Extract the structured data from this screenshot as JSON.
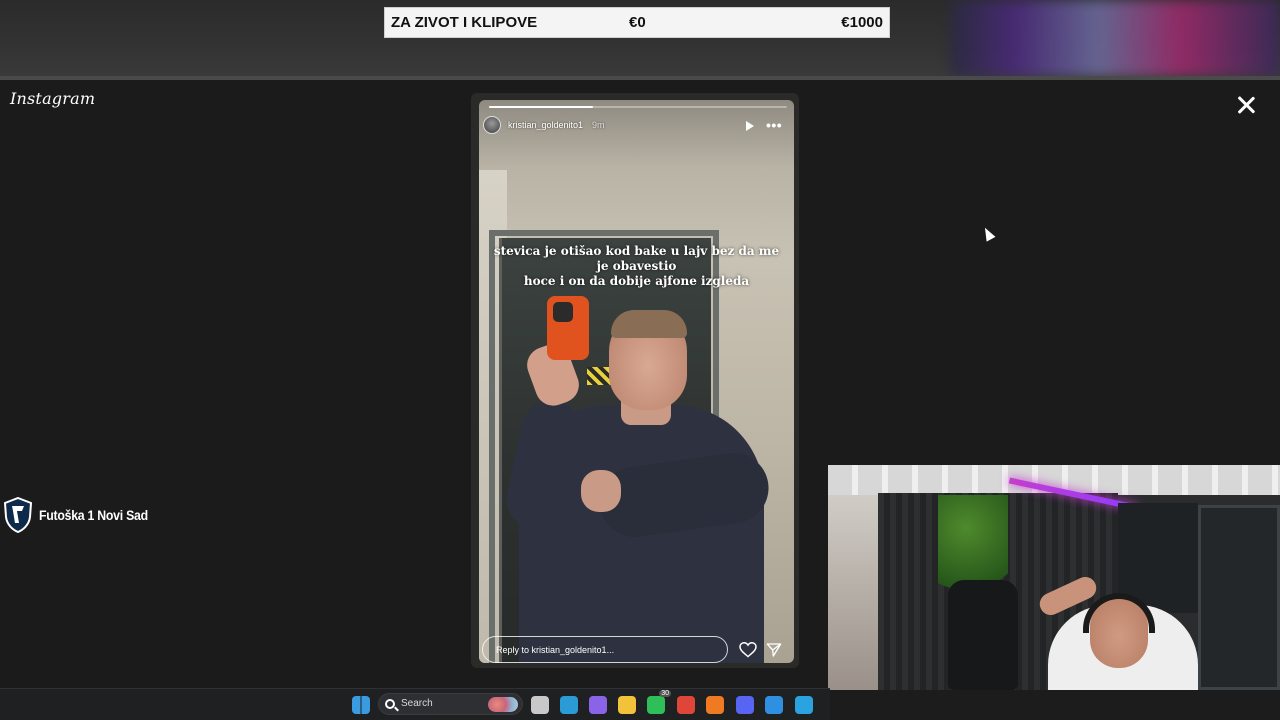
{
  "donation": {
    "title": "ZA ZIVOT I KLIPOVE",
    "current": "€0",
    "goal": "€1000",
    "progress_fraction": 0
  },
  "instagram": {
    "logo_text": "Instagram",
    "story": {
      "username": "kristian_goldenito1",
      "time": "9m",
      "progress_fraction": 0.35,
      "caption_lines": [
        "stevica je otišao kod bake u lajv bez da me",
        "je obavestio",
        "hoce i on da dobije ajfone izgleda"
      ],
      "reply_placeholder": "Reply to kristian_goldenito1..."
    },
    "icons": [
      "close-icon",
      "play-icon",
      "more-icon",
      "heart-icon",
      "send-icon"
    ]
  },
  "watermark": {
    "club_name": "Futoška 1 Novi Sad"
  },
  "taskbar": {
    "search_label": "Search",
    "apps": [
      {
        "name": "windows-start-icon",
        "color": "#3a9be0"
      },
      {
        "name": "task-view-icon",
        "color": "#c8c8c8"
      },
      {
        "name": "edge-icon",
        "color": "#2a9bd4"
      },
      {
        "name": "copilot-icon",
        "color": "#8a64e8"
      },
      {
        "name": "file-explorer-icon",
        "color": "#f2c23a"
      },
      {
        "name": "whatsapp-icon",
        "color": "#2fbf58",
        "badge": "30"
      },
      {
        "name": "chrome-icon",
        "color": "#e0453a"
      },
      {
        "name": "firefox-icon",
        "color": "#f07a22"
      },
      {
        "name": "discord-icon",
        "color": "#5865f2"
      },
      {
        "name": "app-icon",
        "color": "#2f8fe0"
      },
      {
        "name": "telegram-icon",
        "color": "#2aa3e0"
      }
    ]
  },
  "colors": {
    "background": "#1b1b1b",
    "donation_bar": "#f4f4f4"
  }
}
